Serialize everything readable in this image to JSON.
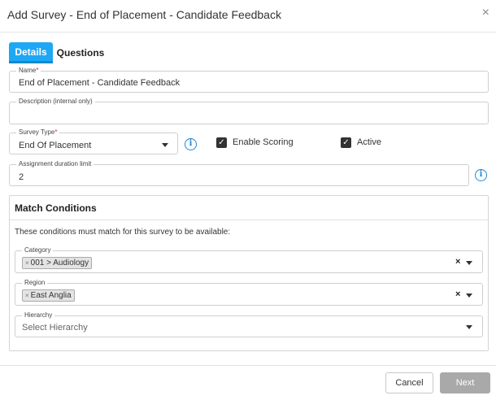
{
  "header": {
    "title": "Add Survey - End of Placement - Candidate Feedback",
    "close_glyph": "×"
  },
  "tabs": [
    {
      "label": "Details",
      "active": true
    },
    {
      "label": "Questions",
      "active": false
    }
  ],
  "fields": {
    "name": {
      "label": "Name",
      "required_mark": "*",
      "value": "End of Placement - Candidate Feedback"
    },
    "description": {
      "label": "Description (internal only)",
      "value": ""
    },
    "survey_type": {
      "label": "Survey Type",
      "required_mark": "*",
      "value": "End Of Placement"
    },
    "assignment_duration": {
      "label": "Assignment duration limit",
      "value": "2"
    }
  },
  "checkboxes": {
    "enable_scoring": {
      "label": "Enable Scoring",
      "checked": true
    },
    "active": {
      "label": "Active",
      "checked": true
    }
  },
  "match_conditions": {
    "title": "Match Conditions",
    "description": "These conditions must match for this survey to be available:",
    "category": {
      "label": "Category",
      "chips": [
        "001 > Audiology"
      ]
    },
    "region": {
      "label": "Region",
      "chips": [
        "East Anglia"
      ]
    },
    "hierarchy": {
      "label": "Hierarchy",
      "placeholder": "Select Hierarchy"
    }
  },
  "icons": {
    "info": "i",
    "check": "✓",
    "chip_remove": "×",
    "clear": "×"
  },
  "footer": {
    "cancel_label": "Cancel",
    "next_label": "Next"
  },
  "colors": {
    "accent": "#1ea7f5",
    "info_icon": "#1e88d8",
    "required": "#e02020",
    "next_button_disabled": "#a9a9a9"
  }
}
